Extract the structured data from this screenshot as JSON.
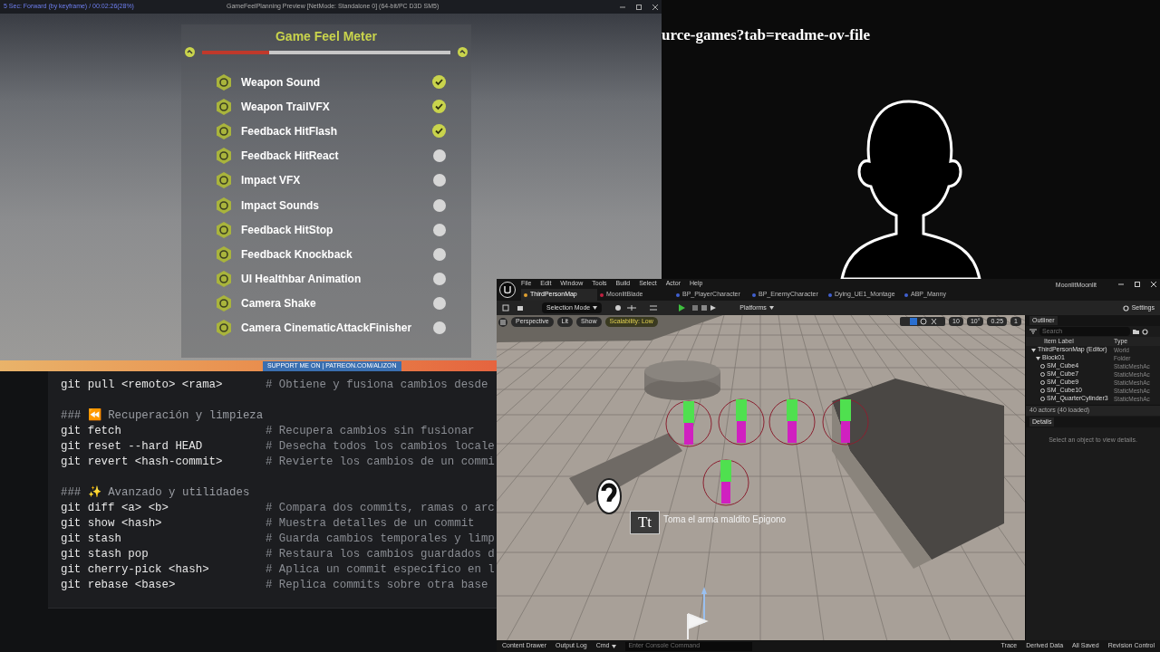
{
  "game_window": {
    "status": "5 Sec: Forward (by keyframe) / 00:02:26(28%)",
    "title": "GameFeelPlanning Preview [NetMode: Standalone 0] (64-bit/PC D3D SM5)",
    "meter": {
      "title": "Game Feel Meter",
      "level": 0.27
    },
    "features": [
      {
        "label": "Weapon Sound",
        "checked": true
      },
      {
        "label": "Weapon TrailVFX",
        "checked": true
      },
      {
        "label": "Feedback HitFlash",
        "checked": true
      },
      {
        "label": "Feedback HitReact",
        "checked": false
      },
      {
        "label": "Impact VFX",
        "checked": false
      },
      {
        "label": "Impact Sounds",
        "checked": false
      },
      {
        "label": "Feedback HitStop",
        "checked": false
      },
      {
        "label": "Feedback Knockback",
        "checked": false
      },
      {
        "label": "UI Healthbar Animation",
        "checked": false
      },
      {
        "label": "Camera Shake",
        "checked": false
      },
      {
        "label": "Camera CinematicAttackFinisher",
        "checked": false
      }
    ]
  },
  "banner": {
    "text": "SUPPORT ME ON | PATREON.COM/ALIZON"
  },
  "browser_url": "urce-games?tab=readme-ov-file",
  "code": [
    {
      "kind": "command",
      "command": "git pull <remoto> <rama>",
      "comment": "# Obtiene y fusiona cambios desde"
    },
    {
      "kind": "blank"
    },
    {
      "kind": "heading",
      "text": "### ⏪ Recuperación y limpieza"
    },
    {
      "kind": "command",
      "command": "git fetch",
      "comment": "# Recupera cambios sin fusionar"
    },
    {
      "kind": "command",
      "command": "git reset --hard HEAD",
      "comment": "# Desecha todos los cambios locale"
    },
    {
      "kind": "command",
      "command": "git revert <hash-commit>",
      "comment": "# Revierte los cambios de un commi"
    },
    {
      "kind": "blank"
    },
    {
      "kind": "heading",
      "text": "### ✨ Avanzado y utilidades"
    },
    {
      "kind": "command",
      "command": "git diff <a> <b>",
      "comment": "# Compara dos commits, ramas o arc"
    },
    {
      "kind": "command",
      "command": "git show <hash>",
      "comment": "# Muestra detalles de un commit"
    },
    {
      "kind": "command",
      "command": "git stash",
      "comment": "# Guarda cambios temporales y limp"
    },
    {
      "kind": "command",
      "command": "git stash pop",
      "comment": "# Restaura los cambios guardados d"
    },
    {
      "kind": "command",
      "command": "git cherry-pick <hash>",
      "comment": "# Aplica un commit específico en l"
    },
    {
      "kind": "command",
      "command": "git rebase <base>",
      "comment": "# Replica commits sobre otra base"
    }
  ],
  "editor": {
    "menu": [
      "File",
      "Edit",
      "Window",
      "Tools",
      "Build",
      "Select",
      "Actor",
      "Help"
    ],
    "project": "MoonlitMoonlit",
    "tabs": [
      {
        "label": "ThirdPersonMap",
        "selected": true
      },
      {
        "label": "MoonlitBlade",
        "selected": false
      },
      {
        "label": "BP_PlayerCharacter",
        "selected": false
      },
      {
        "label": "BP_EnemyCharacter",
        "selected": false
      },
      {
        "label": "Dying_UE1_Montage",
        "selected": false
      },
      {
        "label": "ABP_Manny",
        "selected": false
      }
    ],
    "toolbar": {
      "mode": "Selection Mode",
      "platforms": "Platforms",
      "settings": "Settings"
    },
    "viewport": {
      "buttons": [
        "Perspective",
        "Lit",
        "Show"
      ],
      "scalability": "Scalability: Low",
      "snaps": [
        "10",
        "10°",
        "0.25",
        "1"
      ],
      "caption": "Toma el arma maldito Epigono",
      "text_icon": "Tt"
    },
    "outliner": {
      "title": "Outliner",
      "search_placeholder": "Search",
      "columns": [
        "Item Label",
        "Type"
      ],
      "tree": [
        {
          "label": "ThirdPersonMap (Editor)",
          "type": "World",
          "children": [
            {
              "label": "Block01",
              "type": "Folder",
              "children": [
                {
                  "label": "SM_Cube4",
                  "type": "StaticMeshAc"
                },
                {
                  "label": "SM_Cube7",
                  "type": "StaticMeshAc"
                },
                {
                  "label": "SM_Cube9",
                  "type": "StaticMeshAc"
                },
                {
                  "label": "SM_Cube10",
                  "type": "StaticMeshAc"
                },
                {
                  "label": "SM_QuarterCylinder3",
                  "type": "StaticMeshAc"
                }
              ]
            }
          ]
        }
      ],
      "count": "40 actors (40 loaded)"
    },
    "details": {
      "title": "Details",
      "hint": "Select an object to view details."
    },
    "status_bar": {
      "content_drawer": "Content Drawer",
      "output_log": "Output Log",
      "cmd": "Cmd",
      "console_placeholder": "Enter Console Command",
      "trace": "Trace",
      "derived_data": "Derived Data",
      "saved": "All Saved",
      "revision": "Revision Control"
    }
  }
}
